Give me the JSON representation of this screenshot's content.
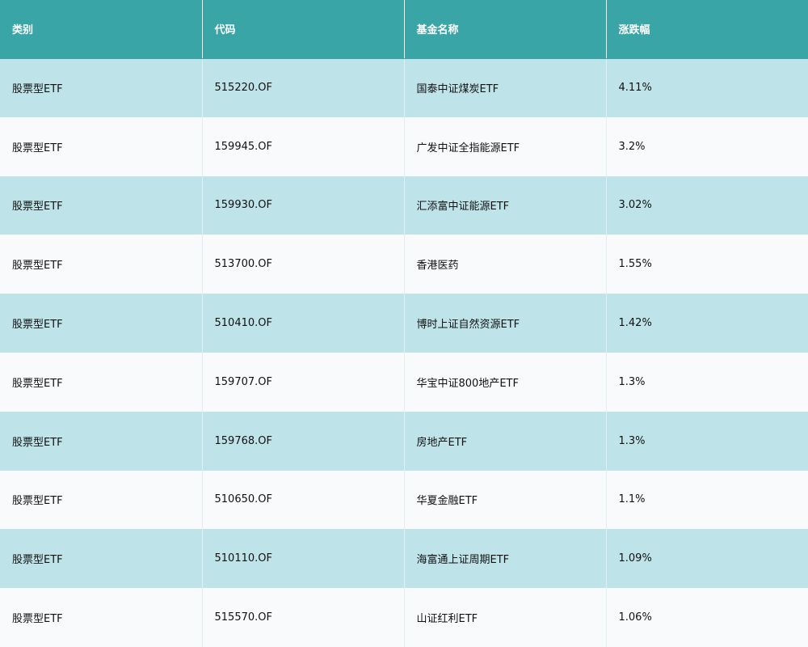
{
  "chart_data": {
    "type": "table",
    "columns": [
      "类别",
      "代码",
      "基金名称",
      "涨跌幅"
    ],
    "rows": [
      [
        "股票型ETF",
        "515220.OF",
        "国泰中证煤炭ETF",
        "4.11%"
      ],
      [
        "股票型ETF",
        "159945.OF",
        "广发中证全指能源ETF",
        "3.2%"
      ],
      [
        "股票型ETF",
        "159930.OF",
        "汇添富中证能源ETF",
        "3.02%"
      ],
      [
        "股票型ETF",
        "513700.OF",
        "香港医药",
        "1.55%"
      ],
      [
        "股票型ETF",
        "510410.OF",
        "博时上证自然资源ETF",
        "1.42%"
      ],
      [
        "股票型ETF",
        "159707.OF",
        "华宝中证800地产ETF",
        "1.3%"
      ],
      [
        "股票型ETF",
        "159768.OF",
        "房地产ETF",
        "1.3%"
      ],
      [
        "股票型ETF",
        "510650.OF",
        "华夏金融ETF",
        "1.1%"
      ],
      [
        "股票型ETF",
        "510110.OF",
        "海富通上证周期ETF",
        "1.09%"
      ],
      [
        "股票型ETF",
        "515570.OF",
        "山证红利ETF",
        "1.06%"
      ]
    ]
  },
  "colors": {
    "header_bg": "#3aa5a7",
    "header_text": "#ffffff",
    "row_odd_bg": "#bee4e9",
    "row_even_bg": "#f8fafc",
    "cell_text": "#111111"
  }
}
